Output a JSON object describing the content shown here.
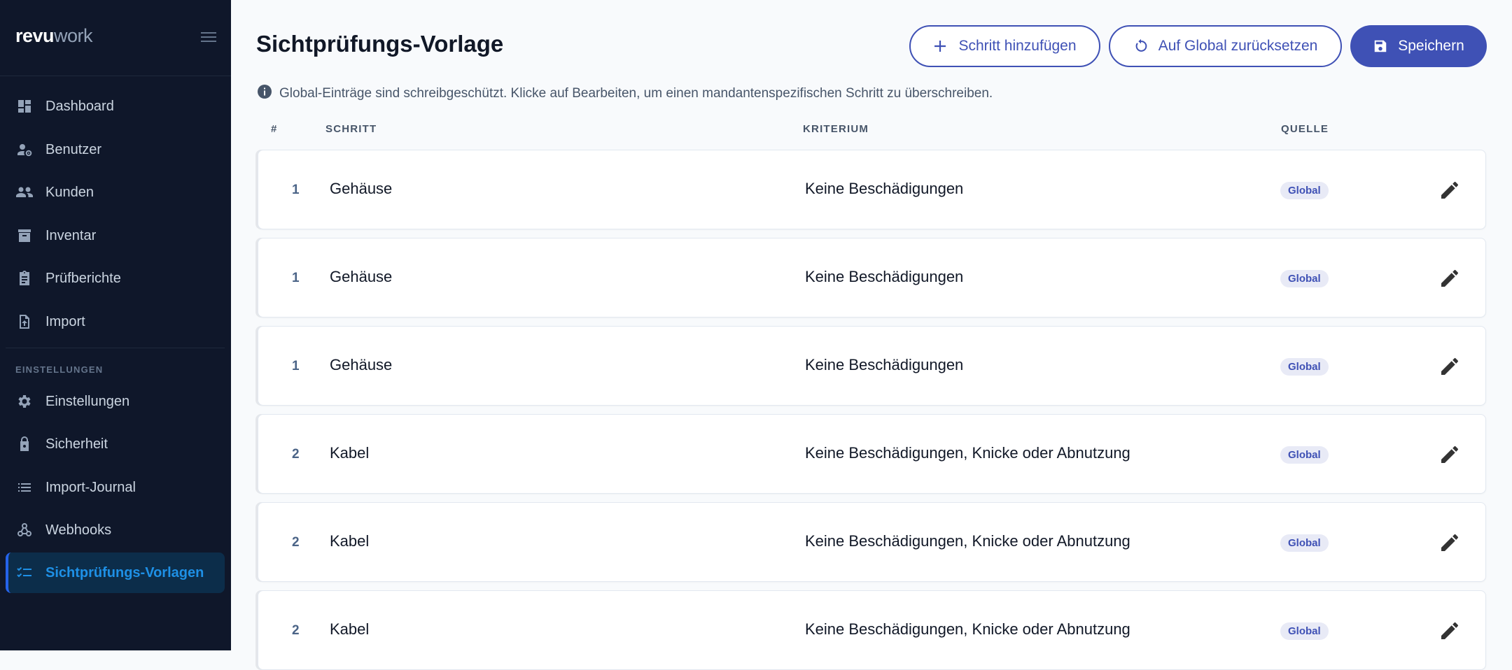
{
  "sidebar": {
    "brand_primary": "revu",
    "brand_secondary": "work",
    "items": [
      {
        "label": "Dashboard",
        "icon": "dashboard-icon"
      },
      {
        "label": "Benutzer",
        "icon": "user-settings-icon"
      },
      {
        "label": "Kunden",
        "icon": "people-icon"
      },
      {
        "label": "Inventar",
        "icon": "archive-icon"
      },
      {
        "label": "Prüfberichte",
        "icon": "clipboard-icon"
      },
      {
        "label": "Import",
        "icon": "file-upload-icon"
      }
    ],
    "section_label": "EINSTELLUNGEN",
    "settings_items": [
      {
        "label": "Einstellungen",
        "icon": "gear-icon"
      },
      {
        "label": "Sicherheit",
        "icon": "lock-icon"
      },
      {
        "label": "Import-Journal",
        "icon": "list-icon"
      },
      {
        "label": "Webhooks",
        "icon": "webhook-icon"
      },
      {
        "label": "Sichtprüfungs-Vorlagen",
        "icon": "checklist-icon",
        "active": true
      }
    ]
  },
  "header": {
    "title": "Sichtprüfungs-Vorlage",
    "add_label": "Schritt hinzufügen",
    "reset_label": "Auf Global zurücksetzen",
    "save_label": "Speichern"
  },
  "info_text": "Global-Einträge sind schreibgeschützt. Klicke auf Bearbeiten, um einen mandantenspezifischen Schritt zu überschreiben.",
  "table": {
    "columns": [
      "#",
      "SCHRITT",
      "KRITERIUM",
      "QUELLE"
    ],
    "rows": [
      {
        "num": "1",
        "step": "Gehäuse",
        "criterion": "Keine Beschädigungen",
        "source": "Global"
      },
      {
        "num": "1",
        "step": "Gehäuse",
        "criterion": "Keine Beschädigungen",
        "source": "Global"
      },
      {
        "num": "1",
        "step": "Gehäuse",
        "criterion": "Keine Beschädigungen",
        "source": "Global"
      },
      {
        "num": "2",
        "step": "Kabel",
        "criterion": "Keine Beschädigungen, Knicke oder Abnutzung",
        "source": "Global"
      },
      {
        "num": "2",
        "step": "Kabel",
        "criterion": "Keine Beschädigungen, Knicke oder Abnutzung",
        "source": "Global"
      },
      {
        "num": "2",
        "step": "Kabel",
        "criterion": "Keine Beschädigungen, Knicke oder Abnutzung",
        "source": "Global"
      }
    ]
  },
  "colors": {
    "sidebar_bg": "#0f172a",
    "accent": "#3f51b5",
    "active_nav": "#1e90e6"
  }
}
